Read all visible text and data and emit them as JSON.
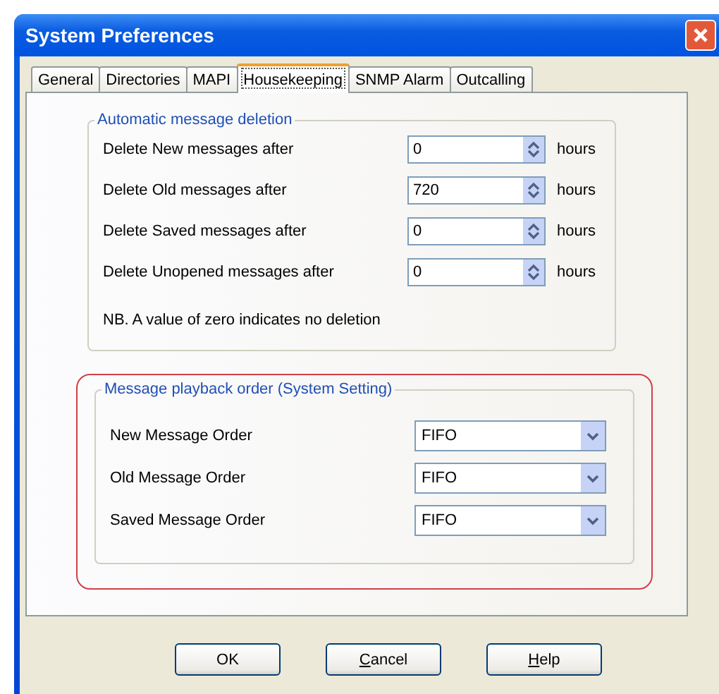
{
  "window": {
    "title": "System Preferences"
  },
  "tabs": [
    {
      "label": "General",
      "selected": false
    },
    {
      "label": "Directories",
      "selected": false
    },
    {
      "label": "MAPI",
      "selected": false
    },
    {
      "label": "Housekeeping",
      "selected": true
    },
    {
      "label": "SNMP Alarm",
      "selected": false
    },
    {
      "label": "Outcalling",
      "selected": false
    }
  ],
  "deletion_group": {
    "title": "Automatic message deletion",
    "rows": [
      {
        "label": "Delete New messages after",
        "value": "0",
        "unit": "hours"
      },
      {
        "label": "Delete Old messages after",
        "value": "720",
        "unit": "hours"
      },
      {
        "label": "Delete Saved messages after",
        "value": "0",
        "unit": "hours"
      },
      {
        "label": "Delete Unopened messages after",
        "value": "0",
        "unit": "hours"
      }
    ],
    "note": "NB. A value of zero indicates no deletion"
  },
  "playback_group": {
    "title": "Message playback order (System Setting)",
    "highlighted": true,
    "rows": [
      {
        "label": "New Message Order",
        "value": "FIFO"
      },
      {
        "label": "Old Message Order",
        "value": "FIFO"
      },
      {
        "label": "Saved Message Order",
        "value": "FIFO"
      }
    ]
  },
  "buttons": [
    {
      "label": "OK",
      "mnemonic": false
    },
    {
      "label": "Cancel",
      "mnemonic": true
    },
    {
      "label": "Help",
      "mnemonic": true
    }
  ]
}
